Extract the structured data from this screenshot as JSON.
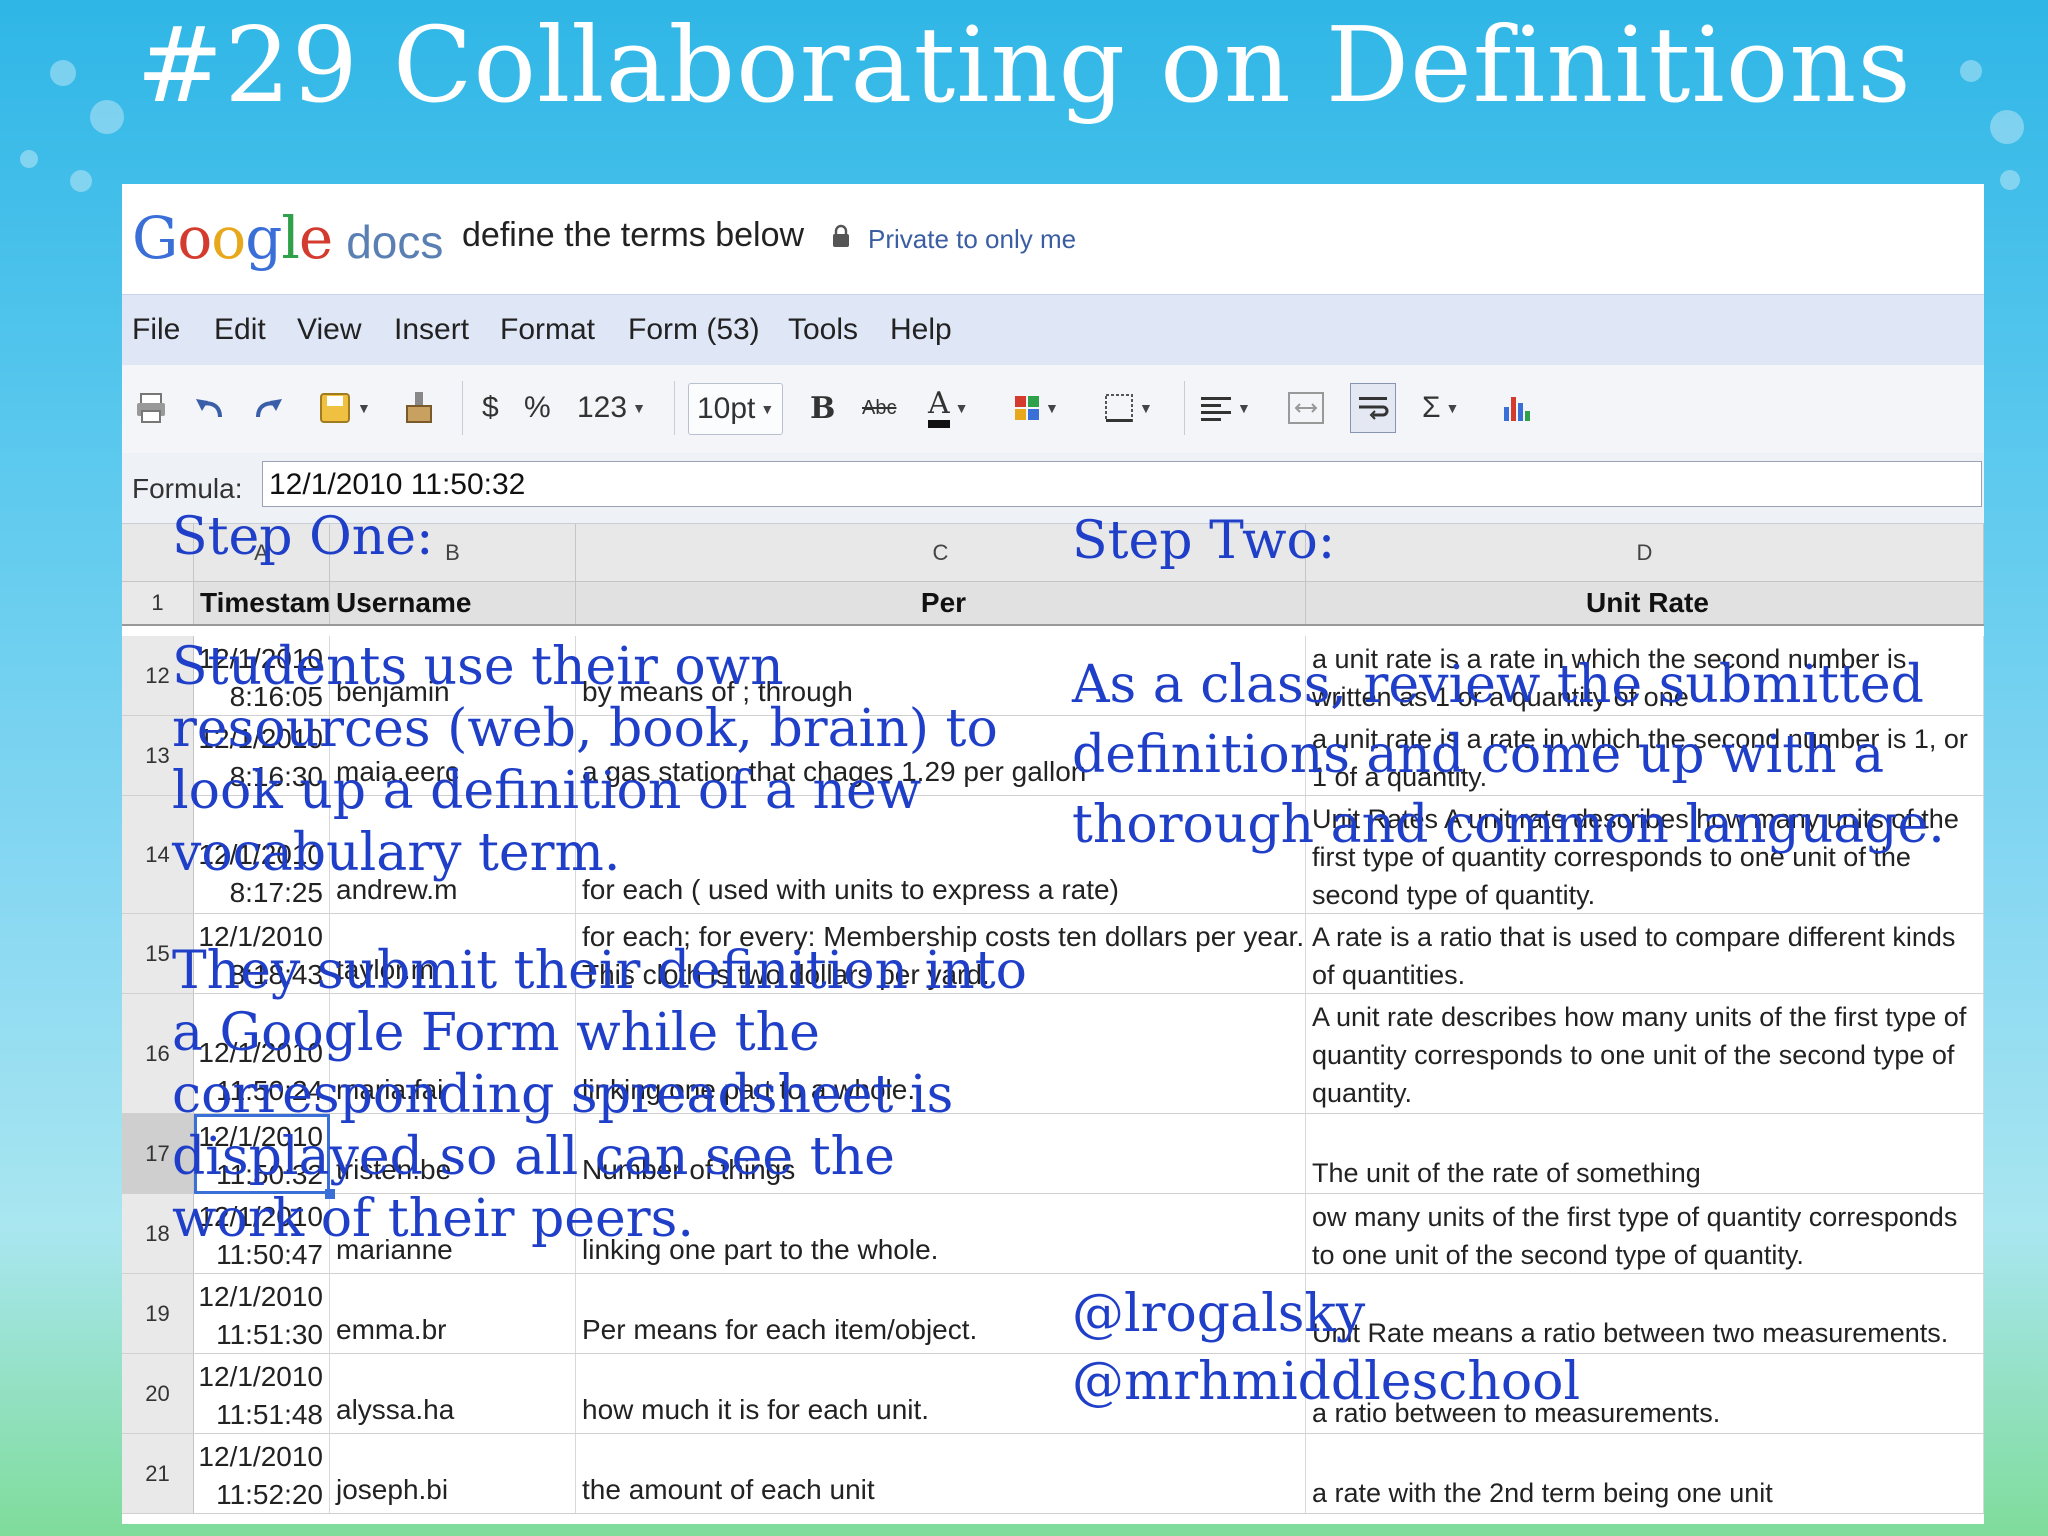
{
  "slide": {
    "title": "#29 Collaborating on Definitions"
  },
  "header": {
    "logo_google": "Google",
    "logo_docs": "docs",
    "doc_title": "define the terms below",
    "privacy": "Private to only me"
  },
  "menu": [
    "File",
    "Edit",
    "View",
    "Insert",
    "Format",
    "Form (53)",
    "Tools",
    "Help"
  ],
  "toolbar": {
    "currency": "$",
    "percent": "%",
    "number_format": "123",
    "font_size": "10pt",
    "bold": "B",
    "strike": "Abc",
    "text_color": "A",
    "sum": "Σ"
  },
  "formula": {
    "label": "Formula:",
    "value": "12/1/2010 11:50:32"
  },
  "grid": {
    "columns": [
      "A",
      "B",
      "C",
      "D"
    ],
    "headers": [
      "Timestamp",
      "Username",
      "Per",
      "Unit Rate"
    ],
    "rows": [
      {
        "n": "12",
        "ts": "12/1/2010\n8:16:05",
        "user": "benjamin",
        "per": "by means of ; through",
        "unit": "a unit rate is a rate in which the second number is written as 1 or a quantity of one"
      },
      {
        "n": "13",
        "ts": "12/1/2010\n8:16:30",
        "user": "maia.eerc",
        "per": "a gas station that chages 1.29 per gallon",
        "unit": "a unit rate is a rate in which the second number is 1, or 1 of a quantity."
      },
      {
        "n": "14",
        "ts": "12/1/2010\n8:17:25",
        "user": "andrew.m",
        "per": "for each ( used with units to express a rate)",
        "unit": "Unit Rates A unit rate describes how many units of the first type of quantity corresponds to one unit of the second type of quantity."
      },
      {
        "n": "15",
        "ts": "12/1/2010\n8:18:43",
        "user": "taylor.m",
        "per": "for each; for every: Membership costs ten dollars per year. This cloth is two dollars per yard.",
        "unit": "A rate is a ratio that is used to compare different kinds of quantities."
      },
      {
        "n": "16",
        "ts": "12/1/2010\n11:50:24",
        "user": "maria.fai",
        "per": "linking one part to a whole.",
        "unit": "A unit rate describes how many units of the first type of quantity corresponds to one unit of the second type of quantity."
      },
      {
        "n": "17",
        "ts": "12/1/2010\n11:50:32",
        "user": "tristen.be",
        "per": "Number of things",
        "unit": "The unit of the rate of something"
      },
      {
        "n": "18",
        "ts": "12/1/2010\n11:50:47",
        "user": "marianne",
        "per": "linking one part to the whole.",
        "unit": "ow many units of the first type of quantity corresponds to one unit of the second type of quantity."
      },
      {
        "n": "19",
        "ts": "12/1/2010\n11:51:30",
        "user": "emma.br",
        "per": "Per means for each item/object.",
        "unit": "Unit Rate means a ratio between two measurements."
      },
      {
        "n": "20",
        "ts": "12/1/2010\n11:51:48",
        "user": "alyssa.ha",
        "per": "how much it is for each unit.",
        "unit": "a ratio between to measurements."
      },
      {
        "n": "21",
        "ts": "12/1/2010\n11:52:20",
        "user": "joseph.bi",
        "per": "the amount of each unit",
        "unit": "a rate with the 2nd term being one unit"
      }
    ]
  },
  "overlay": {
    "step_one_heading": "Step One:",
    "step_one_text": "Students use their own resources (web, book, brain) to look up a definition of a new vocabulary term.",
    "step_one_text2": "They submit their definition into a Google Form while the corresponding spreadsheet is displayed so all can see the work of their peers.",
    "step_two_heading": "Step Two:",
    "step_two_text": "As a class, review the submitted definitions and come up with a thorough and common language.",
    "handle1": "@lrogalsky",
    "handle2": "@mrhmiddleschool"
  },
  "colors": {
    "overlay_text": "#1f3fc8",
    "title_text": "#ffffff",
    "menubar": "#dfe6f6"
  }
}
